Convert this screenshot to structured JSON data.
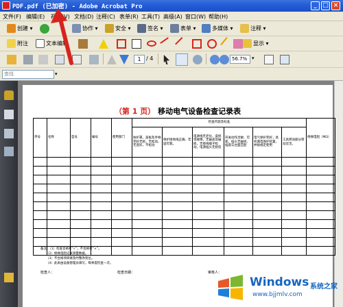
{
  "window": {
    "title": "PDF.pdf (已加密) - Adobe Acrobat Pro",
    "buttons": [
      "_",
      "□",
      "×"
    ]
  },
  "menu": [
    "文件(F)",
    "编辑(E)",
    "视图(V)",
    "文档(D)",
    "注释(C)",
    "表单(R)",
    "工具(T)",
    "高级(A)",
    "窗口(W)",
    "帮助(H)"
  ],
  "toolbar1": {
    "create": "创建",
    "collaborate": "协作",
    "security": "安全",
    "sign": "签名",
    "forms": "表单",
    "multimedia": "多媒体",
    "comment": "注释"
  },
  "toolbar2": {
    "attach": "附注",
    "text_edit": "文本编辑",
    "show": "显示"
  },
  "toolbar3": {
    "page_current": "1",
    "page_total": "/ 4",
    "zoom": "56.7%"
  },
  "search": {
    "placeholder": "查找"
  },
  "document": {
    "title_prefix": "（第 1 页）",
    "title_main": "移动电气设备检查记录表",
    "columns": {
      "c1": "序号",
      "c2": "名称",
      "c3": "型号",
      "c4": "编号",
      "c5": "使用部门",
      "group": "检查内容及标准",
      "g1": "防护罩，盖板及手柄完好无损，无松动，无变形，不松动",
      "g2": "保护接地线正确、牢固可靠。",
      "g3": "电源线无老化、皮损等故障，无破皮及破损，无接线端子松动，电源插头无损伤",
      "g4": "开关动作灵敏、可靠，插头无破损、插座与台面匹配",
      "g5": "电气保护完好，具有漏电保护装置，并按规定使用",
      "g6": "工具转动部分转动灵活，",
      "c_last": "绝缘电阻（MΩ）"
    },
    "notes": [
      "备注：（1）检查合格打“√”，不合格打“×”。",
      "（2）绝缘电阻记录测量数据。",
      "（3）不合格项目要及时整改到位。",
      "（4）此表由设备管理员填写，每季度检查一次。"
    ],
    "footer": {
      "inspector": "检查人：",
      "date": "检查日期：",
      "other": "审核人："
    }
  },
  "watermark": {
    "brand": "Windows",
    "brand_cn": "系统之家",
    "url": "www.bjjmlv.com"
  },
  "colors": {
    "accent_red": "#d8231c",
    "titlebar_blue": "#245edb",
    "watermark_blue": "#1565c0"
  },
  "icons": [
    "create-icon",
    "collaborate-icon",
    "security-icon",
    "sign-icon",
    "forms-icon",
    "multimedia-icon",
    "comment-icon",
    "note-icon",
    "text-edit-icon",
    "stamp-icon",
    "open-icon",
    "print-icon",
    "save-icon",
    "email-icon",
    "search-icon",
    "prev-page-icon",
    "next-page-icon",
    "select-icon",
    "hand-icon",
    "zoom-tool-icon",
    "zoom-out-icon",
    "zoom-in-icon",
    "lock-icon",
    "pages-icon",
    "attachments-icon",
    "signatures-icon",
    "comments-icon"
  ]
}
